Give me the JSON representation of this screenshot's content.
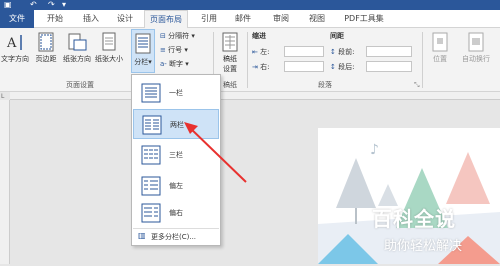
{
  "tabs": {
    "file": "文件",
    "home": "开始",
    "insert": "插入",
    "design": "设计",
    "layout": "页面布局",
    "references": "引用",
    "mailings": "邮件",
    "review": "审阅",
    "view": "视图",
    "pdf": "PDF工具集"
  },
  "ribbon": {
    "text_direction": "文字方向",
    "margins": "页边距",
    "orientation": "纸张方向",
    "size": "纸张大小",
    "columns": "分栏",
    "breaks": "分隔符",
    "line_numbers": "行号",
    "hyphenation": "断字",
    "draft_paper": "稿纸",
    "draft_paper_2": "设置",
    "indent": "缩进",
    "spacing": "间距",
    "indent_left": "左:",
    "indent_right": "右:",
    "spacing_before": "段前:",
    "spacing_after": "段后:",
    "position": "位置",
    "wrap": "自动换行",
    "group_page_setup": "页面设置",
    "group_draft": "稿纸",
    "group_paragraph": "段落"
  },
  "columns_menu": {
    "one": "一栏",
    "two": "两栏",
    "three": "三栏",
    "left": "偏左",
    "right": "偏右",
    "more": "更多分栏(C)..."
  },
  "watermark": {
    "title": "百科全说",
    "subtitle": "助你轻松解决"
  },
  "colors": {
    "accent": "#2b579a",
    "highlight": "#cfe3f7",
    "arrow": "#e8312f"
  }
}
